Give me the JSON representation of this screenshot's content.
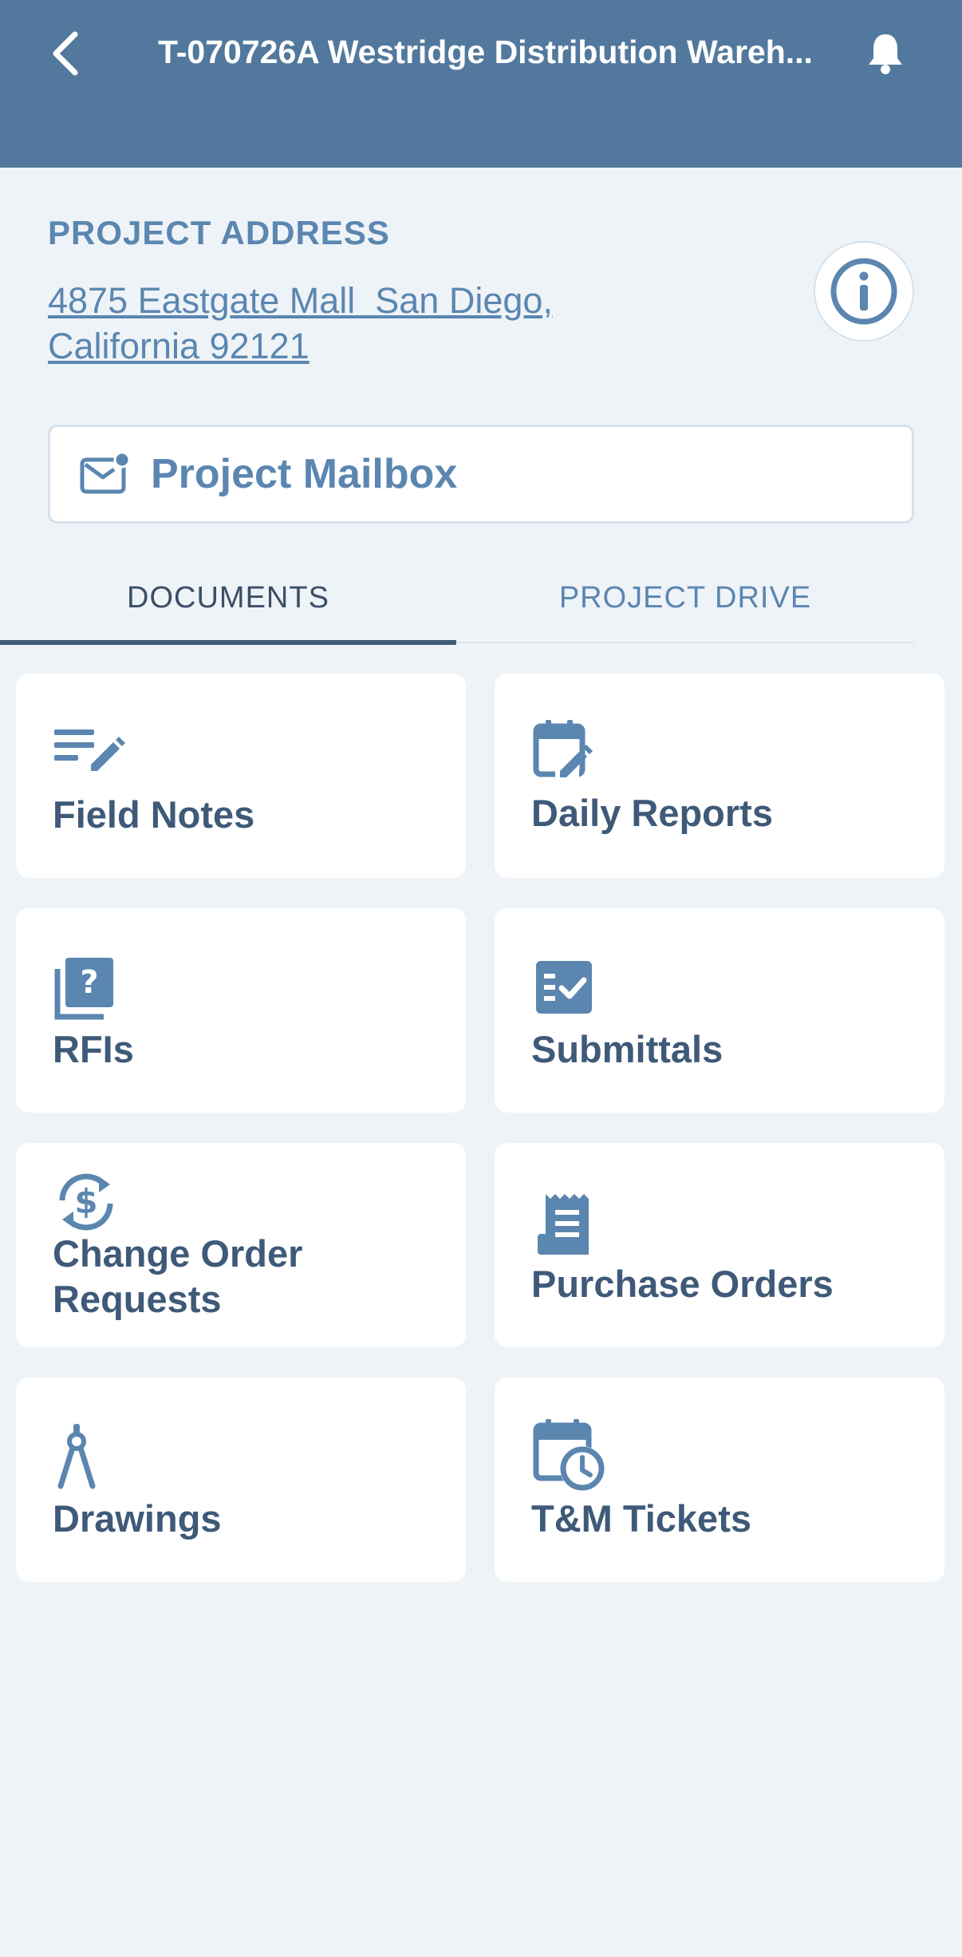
{
  "header": {
    "title": "T-070726A Westridge Distribution Wareh...",
    "back_icon": "chevron-left-icon",
    "bell_icon": "bell-icon"
  },
  "project": {
    "address_label": "PROJECT ADDRESS",
    "address_line1": "4875 Eastgate Mall  San Diego,",
    "address_line2": "California 92121",
    "info_icon": "info-icon"
  },
  "mailbox": {
    "label": "Project Mailbox",
    "icon": "mail-notification-icon"
  },
  "tabs": [
    {
      "label": "DOCUMENTS",
      "active": true
    },
    {
      "label": "PROJECT DRIVE",
      "active": false
    }
  ],
  "cards": [
    {
      "label": "Field Notes",
      "icon": "notes-edit-icon"
    },
    {
      "label": "Daily Reports",
      "icon": "calendar-edit-icon"
    },
    {
      "label": "RFIs",
      "icon": "question-book-icon"
    },
    {
      "label": "Submittals",
      "icon": "checklist-icon"
    },
    {
      "label": "Change Order Requests",
      "icon": "dollar-exchange-icon"
    },
    {
      "label": "Purchase Orders",
      "icon": "receipt-icon"
    },
    {
      "label": "Drawings",
      "icon": "compass-icon"
    },
    {
      "label": "T&M Tickets",
      "icon": "calendar-clock-icon"
    }
  ],
  "colors": {
    "header_bg": "#52799d",
    "accent": "#5b86b0",
    "text_dark": "#3f5a78",
    "page_bg": "#eef3f8"
  }
}
